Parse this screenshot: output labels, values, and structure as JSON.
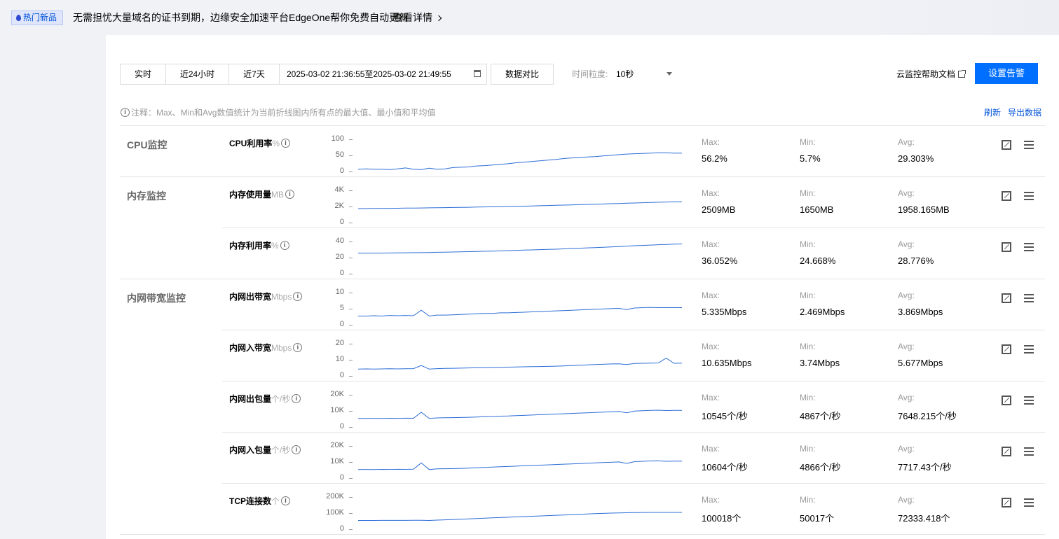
{
  "banner": {
    "badge": "热门新品",
    "text": "无需担忧大量域名的证书到期，边缘安全加速平台EdgeOne帮你免费自动更新",
    "link": "查看详情"
  },
  "toolbar": {
    "time_buttons": [
      "实时",
      "近24小时",
      "近7天"
    ],
    "date_range": "2025-03-02 21:36:55至2025-03-02 21:49:55",
    "compare": "数据对比",
    "granularity_label": "时间粒度:",
    "granularity_value": "10秒",
    "help": "云监控帮助文档",
    "alarm": "设置告警"
  },
  "note": "注释：Max、Min和Avg数值统计为当前折线图内所有点的最大值、最小值和平均值",
  "actions": {
    "refresh": "刷新",
    "export": "导出数据"
  },
  "stat_labels": {
    "max": "Max:",
    "min": "Min:",
    "avg": "Avg:"
  },
  "groups": [
    {
      "label": "CPU监控"
    },
    {
      "label": "内存监控"
    },
    {
      "label": "内网带宽监控"
    }
  ],
  "metrics": [
    {
      "name": "CPU利用率",
      "unit": "%",
      "yticks": [
        "100",
        "50",
        "0"
      ],
      "ymax": 100,
      "points": [
        5,
        6,
        5,
        5,
        4,
        6,
        9,
        5,
        4,
        8,
        5,
        6,
        10,
        11,
        12,
        15,
        16,
        18,
        20,
        22,
        25,
        27,
        29,
        31,
        33,
        35,
        38,
        40,
        41,
        43,
        44,
        46,
        48,
        50,
        52,
        53,
        54,
        55,
        56,
        56,
        55,
        55
      ],
      "max": "56.2%",
      "min": "5.7%",
      "avg": "29.303%"
    },
    {
      "name": "内存使用量",
      "unit": "MB",
      "yticks": [
        "4K",
        "2K",
        "0"
      ],
      "ymax": 4000,
      "points": [
        1650,
        1660,
        1670,
        1680,
        1690,
        1700,
        1710,
        1720,
        1730,
        1745,
        1760,
        1775,
        1790,
        1805,
        1820,
        1840,
        1860,
        1880,
        1900,
        1920,
        1940,
        1960,
        1985,
        2010,
        2035,
        2060,
        2085,
        2110,
        2140,
        2170,
        2200,
        2230,
        2260,
        2290,
        2320,
        2350,
        2380,
        2410,
        2440,
        2470,
        2490,
        2509
      ],
      "max": "2509MB",
      "min": "1650MB",
      "avg": "1958.165MB"
    },
    {
      "name": "内存利用率",
      "unit": "%",
      "yticks": [
        "40",
        "20",
        "0"
      ],
      "ymax": 40,
      "points": [
        24.7,
        24.7,
        24.8,
        24.8,
        24.9,
        25.0,
        25.1,
        25.2,
        25.3,
        25.5,
        25.7,
        25.9,
        26.1,
        26.3,
        26.5,
        26.7,
        27.0,
        27.2,
        27.5,
        27.8,
        28.1,
        28.4,
        28.7,
        29.0,
        29.3,
        29.6,
        30.0,
        30.4,
        30.8,
        31.2,
        31.6,
        32.0,
        32.4,
        32.9,
        33.4,
        33.9,
        34.3,
        34.7,
        35.1,
        35.5,
        35.8,
        36.05
      ],
      "max": "36.052%",
      "min": "24.668%",
      "avg": "28.776%"
    },
    {
      "name": "内网出带宽",
      "unit": "Mbps",
      "yticks": [
        "10",
        "5",
        "0"
      ],
      "ymax": 10,
      "points": [
        2.5,
        2.5,
        2.6,
        2.5,
        2.7,
        2.6,
        2.7,
        2.6,
        4.3,
        2.5,
        2.8,
        2.8,
        2.9,
        3.0,
        3.1,
        3.2,
        3.3,
        3.3,
        3.5,
        3.5,
        3.6,
        3.7,
        3.8,
        3.9,
        4.0,
        4.1,
        4.2,
        4.3,
        4.4,
        4.5,
        4.6,
        4.7,
        4.8,
        4.9,
        4.5,
        5.0,
        5.1,
        5.2,
        5.1,
        5.1,
        5.1,
        5.1
      ],
      "max": "5.335Mbps",
      "min": "2.469Mbps",
      "avg": "3.869Mbps"
    },
    {
      "name": "内网入带宽",
      "unit": "Mbps",
      "yticks": [
        "20",
        "10",
        "0"
      ],
      "ymax": 20,
      "points": [
        3.8,
        3.9,
        3.8,
        3.9,
        4.0,
        3.9,
        4.0,
        4.1,
        6.0,
        3.8,
        4.1,
        4.2,
        4.3,
        4.4,
        4.5,
        4.6,
        4.7,
        4.8,
        4.9,
        5.0,
        5.1,
        5.2,
        5.3,
        5.4,
        5.5,
        5.6,
        5.8,
        6.0,
        6.2,
        6.4,
        6.6,
        6.8,
        7.0,
        7.1,
        6.6,
        7.3,
        7.4,
        7.5,
        7.6,
        10.6,
        7.4,
        7.5
      ],
      "max": "10.635Mbps",
      "min": "3.74Mbps",
      "avg": "5.677Mbps"
    },
    {
      "name": "内网出包量",
      "unit": "个/秒",
      "yticks": [
        "20K",
        "10K",
        "0"
      ],
      "ymax": 20000,
      "points": [
        4900,
        4900,
        4950,
        4900,
        5000,
        4950,
        5050,
        5000,
        8700,
        4870,
        5200,
        5300,
        5400,
        5500,
        5600,
        5800,
        6000,
        6100,
        6300,
        6400,
        6600,
        6800,
        7000,
        7200,
        7400,
        7600,
        7800,
        8000,
        8200,
        8400,
        8600,
        8800,
        9000,
        9200,
        8400,
        9500,
        9700,
        9900,
        10000,
        9800,
        9900,
        9900
      ],
      "max": "10545个/秒",
      "min": "4867个/秒",
      "avg": "7648.215个/秒"
    },
    {
      "name": "内网入包量",
      "unit": "个/秒",
      "yticks": [
        "20K",
        "10K",
        "0"
      ],
      "ymax": 20000,
      "points": [
        4900,
        4950,
        4900,
        5000,
        4950,
        5050,
        5000,
        5100,
        9000,
        4870,
        5300,
        5400,
        5500,
        5600,
        5800,
        6000,
        6200,
        6400,
        6600,
        6800,
        7000,
        7200,
        7400,
        7600,
        7800,
        8000,
        8200,
        8400,
        8600,
        8800,
        9000,
        9200,
        9400,
        9600,
        8700,
        9800,
        10000,
        10200,
        10300,
        10000,
        10100,
        10100
      ],
      "max": "10604个/秒",
      "min": "4866个/秒",
      "avg": "7717.43个/秒"
    },
    {
      "name": "TCP连接数",
      "unit": "个",
      "yticks": [
        "200K",
        "100K",
        "0"
      ],
      "ymax": 200000,
      "points": [
        50000,
        50100,
        50200,
        50300,
        50400,
        50500,
        50600,
        50800,
        51000,
        50017,
        52000,
        54000,
        56000,
        58000,
        60000,
        62000,
        64000,
        66000,
        68000,
        70000,
        72000,
        74000,
        76000,
        78000,
        80000,
        82000,
        84000,
        86000,
        88000,
        90000,
        92000,
        94000,
        95500,
        97000,
        98000,
        99000,
        99500,
        100000,
        100018,
        100000,
        100000,
        100000
      ],
      "max": "100018个",
      "min": "50017个",
      "avg": "72333.418个"
    }
  ],
  "colors": {
    "accent": "#006eff",
    "line": "#2b6cd6",
    "link": "#0052d9"
  }
}
